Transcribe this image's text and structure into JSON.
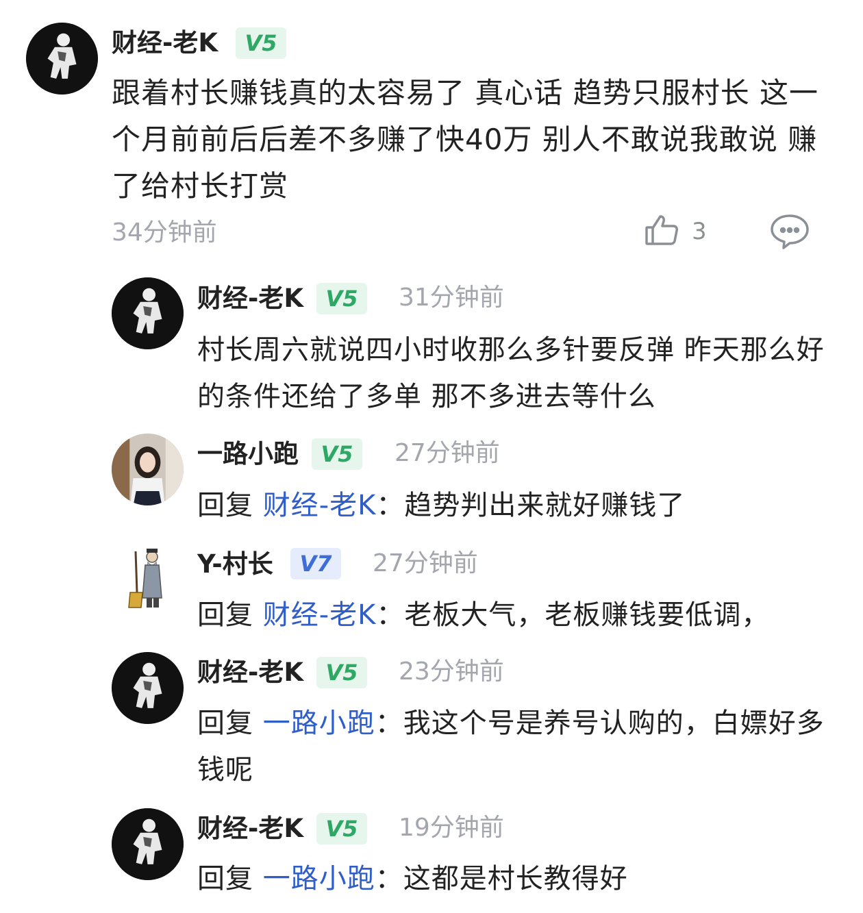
{
  "comment": {
    "user": "财经-老K",
    "level": "V5",
    "text": "跟着村长赚钱真的太容易了 真心话 趋势只服村长 这一个月前前后后差不多赚了快40万 别人不敢说我敢说 赚了给村长打赏",
    "time": "34分钟前",
    "likes": "3",
    "icons": {
      "like": "thumbs-up-icon",
      "reply": "comment-bubble-icon"
    }
  },
  "replies": [
    {
      "user": "财经-老K",
      "level": "V5",
      "time": "31分钟前",
      "prefix": "",
      "mention": "",
      "sep": "",
      "text": "村长周六就说四小时收那么多针要反弹 昨天那么好的条件还给了多单 那不多进去等什么"
    },
    {
      "user": "一路小跑",
      "level": "V5",
      "time": "27分钟前",
      "prefix": "回复 ",
      "mention": "财经-老K",
      "sep": "：",
      "text": "趋势判出来就好赚钱了"
    },
    {
      "user": "Y-村长",
      "level": "V7",
      "time": "27分钟前",
      "prefix": "回复 ",
      "mention": "财经-老K",
      "sep": "：",
      "text": "老板大气，老板赚钱要低调，"
    },
    {
      "user": "财经-老K",
      "level": "V5",
      "time": "23分钟前",
      "prefix": "回复 ",
      "mention": "一路小跑",
      "sep": "：",
      "text": "我这个号是养号认购的，白嫖好多钱呢"
    },
    {
      "user": "财经-老K",
      "level": "V5",
      "time": "19分钟前",
      "prefix": "回复 ",
      "mention": "一路小跑",
      "sep": "：",
      "text": "这都是村长教得好"
    }
  ],
  "colors": {
    "v5_text": "#2fa866",
    "v5_bg": "#e6f6ec",
    "v7_text": "#3d6dd6",
    "v7_bg": "#e5ecfb",
    "mention": "#2f5ec8",
    "time": "#a3a6ad"
  }
}
